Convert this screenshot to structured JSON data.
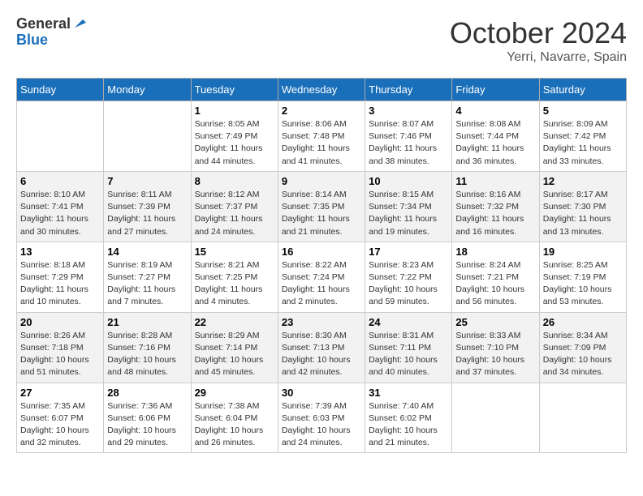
{
  "header": {
    "logo_general": "General",
    "logo_blue": "Blue",
    "month_title": "October 2024",
    "location": "Yerri, Navarre, Spain"
  },
  "weekdays": [
    "Sunday",
    "Monday",
    "Tuesday",
    "Wednesday",
    "Thursday",
    "Friday",
    "Saturday"
  ],
  "weeks": [
    [
      {
        "day": "",
        "detail": ""
      },
      {
        "day": "",
        "detail": ""
      },
      {
        "day": "1",
        "detail": "Sunrise: 8:05 AM\nSunset: 7:49 PM\nDaylight: 11 hours and 44 minutes."
      },
      {
        "day": "2",
        "detail": "Sunrise: 8:06 AM\nSunset: 7:48 PM\nDaylight: 11 hours and 41 minutes."
      },
      {
        "day": "3",
        "detail": "Sunrise: 8:07 AM\nSunset: 7:46 PM\nDaylight: 11 hours and 38 minutes."
      },
      {
        "day": "4",
        "detail": "Sunrise: 8:08 AM\nSunset: 7:44 PM\nDaylight: 11 hours and 36 minutes."
      },
      {
        "day": "5",
        "detail": "Sunrise: 8:09 AM\nSunset: 7:42 PM\nDaylight: 11 hours and 33 minutes."
      }
    ],
    [
      {
        "day": "6",
        "detail": "Sunrise: 8:10 AM\nSunset: 7:41 PM\nDaylight: 11 hours and 30 minutes."
      },
      {
        "day": "7",
        "detail": "Sunrise: 8:11 AM\nSunset: 7:39 PM\nDaylight: 11 hours and 27 minutes."
      },
      {
        "day": "8",
        "detail": "Sunrise: 8:12 AM\nSunset: 7:37 PM\nDaylight: 11 hours and 24 minutes."
      },
      {
        "day": "9",
        "detail": "Sunrise: 8:14 AM\nSunset: 7:35 PM\nDaylight: 11 hours and 21 minutes."
      },
      {
        "day": "10",
        "detail": "Sunrise: 8:15 AM\nSunset: 7:34 PM\nDaylight: 11 hours and 19 minutes."
      },
      {
        "day": "11",
        "detail": "Sunrise: 8:16 AM\nSunset: 7:32 PM\nDaylight: 11 hours and 16 minutes."
      },
      {
        "day": "12",
        "detail": "Sunrise: 8:17 AM\nSunset: 7:30 PM\nDaylight: 11 hours and 13 minutes."
      }
    ],
    [
      {
        "day": "13",
        "detail": "Sunrise: 8:18 AM\nSunset: 7:29 PM\nDaylight: 11 hours and 10 minutes."
      },
      {
        "day": "14",
        "detail": "Sunrise: 8:19 AM\nSunset: 7:27 PM\nDaylight: 11 hours and 7 minutes."
      },
      {
        "day": "15",
        "detail": "Sunrise: 8:21 AM\nSunset: 7:25 PM\nDaylight: 11 hours and 4 minutes."
      },
      {
        "day": "16",
        "detail": "Sunrise: 8:22 AM\nSunset: 7:24 PM\nDaylight: 11 hours and 2 minutes."
      },
      {
        "day": "17",
        "detail": "Sunrise: 8:23 AM\nSunset: 7:22 PM\nDaylight: 10 hours and 59 minutes."
      },
      {
        "day": "18",
        "detail": "Sunrise: 8:24 AM\nSunset: 7:21 PM\nDaylight: 10 hours and 56 minutes."
      },
      {
        "day": "19",
        "detail": "Sunrise: 8:25 AM\nSunset: 7:19 PM\nDaylight: 10 hours and 53 minutes."
      }
    ],
    [
      {
        "day": "20",
        "detail": "Sunrise: 8:26 AM\nSunset: 7:18 PM\nDaylight: 10 hours and 51 minutes."
      },
      {
        "day": "21",
        "detail": "Sunrise: 8:28 AM\nSunset: 7:16 PM\nDaylight: 10 hours and 48 minutes."
      },
      {
        "day": "22",
        "detail": "Sunrise: 8:29 AM\nSunset: 7:14 PM\nDaylight: 10 hours and 45 minutes."
      },
      {
        "day": "23",
        "detail": "Sunrise: 8:30 AM\nSunset: 7:13 PM\nDaylight: 10 hours and 42 minutes."
      },
      {
        "day": "24",
        "detail": "Sunrise: 8:31 AM\nSunset: 7:11 PM\nDaylight: 10 hours and 40 minutes."
      },
      {
        "day": "25",
        "detail": "Sunrise: 8:33 AM\nSunset: 7:10 PM\nDaylight: 10 hours and 37 minutes."
      },
      {
        "day": "26",
        "detail": "Sunrise: 8:34 AM\nSunset: 7:09 PM\nDaylight: 10 hours and 34 minutes."
      }
    ],
    [
      {
        "day": "27",
        "detail": "Sunrise: 7:35 AM\nSunset: 6:07 PM\nDaylight: 10 hours and 32 minutes."
      },
      {
        "day": "28",
        "detail": "Sunrise: 7:36 AM\nSunset: 6:06 PM\nDaylight: 10 hours and 29 minutes."
      },
      {
        "day": "29",
        "detail": "Sunrise: 7:38 AM\nSunset: 6:04 PM\nDaylight: 10 hours and 26 minutes."
      },
      {
        "day": "30",
        "detail": "Sunrise: 7:39 AM\nSunset: 6:03 PM\nDaylight: 10 hours and 24 minutes."
      },
      {
        "day": "31",
        "detail": "Sunrise: 7:40 AM\nSunset: 6:02 PM\nDaylight: 10 hours and 21 minutes."
      },
      {
        "day": "",
        "detail": ""
      },
      {
        "day": "",
        "detail": ""
      }
    ]
  ]
}
